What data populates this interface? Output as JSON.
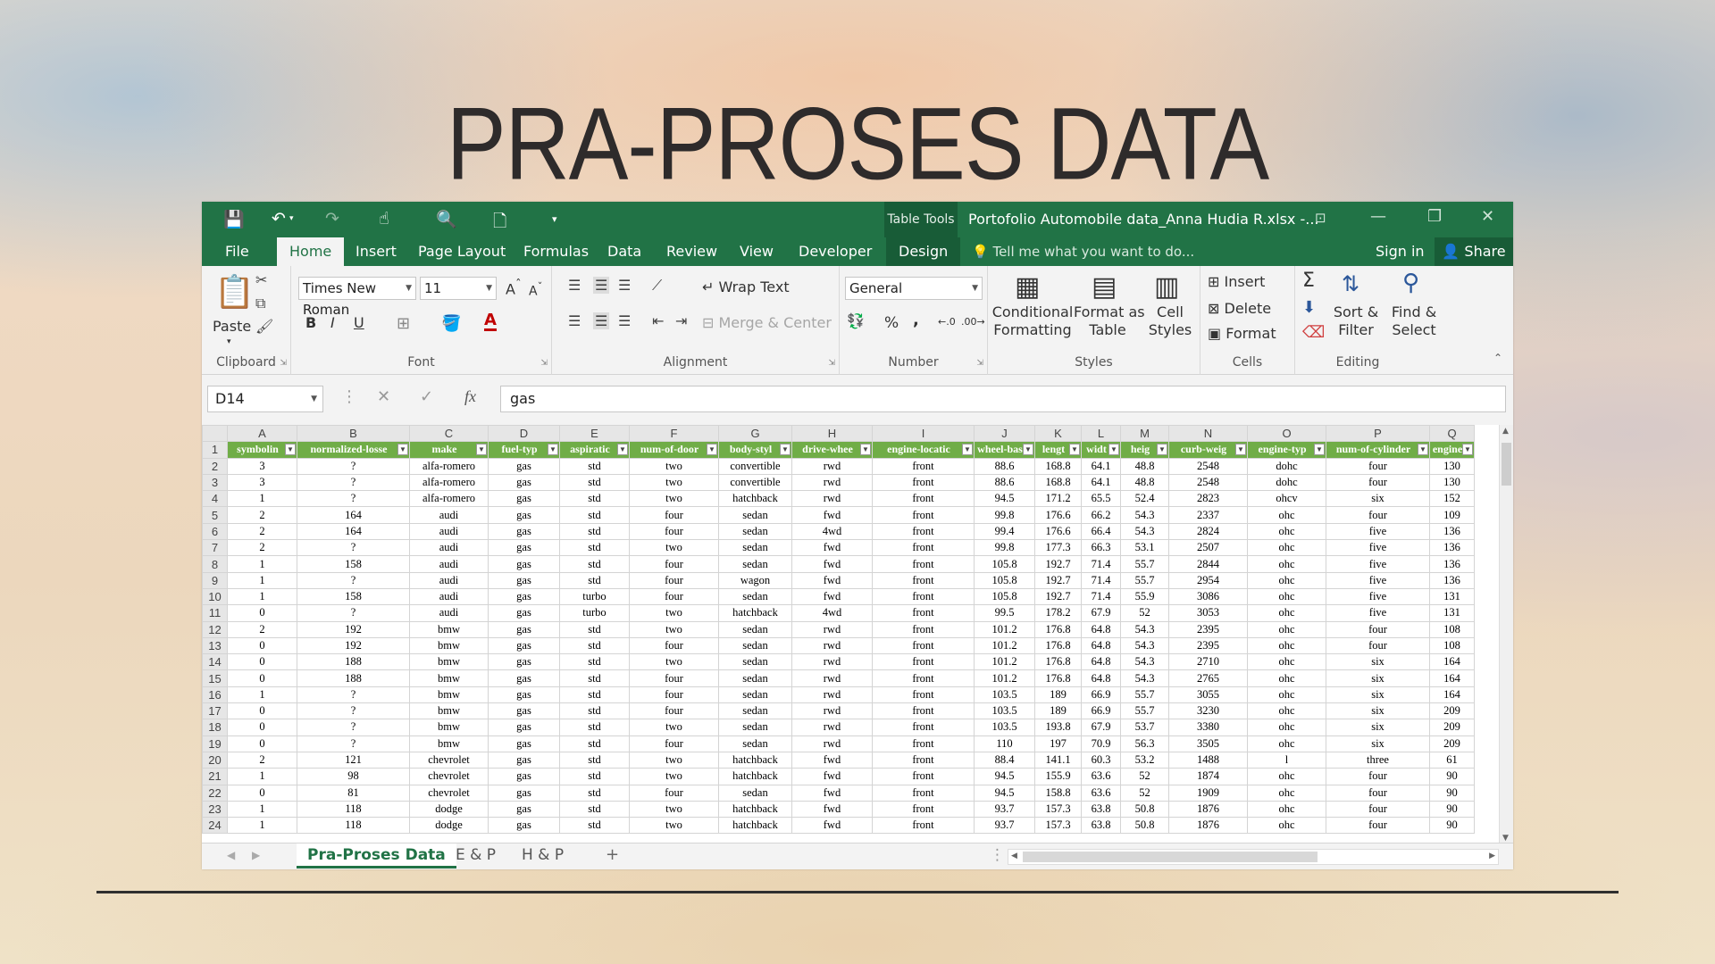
{
  "slide": {
    "title": "PRA-PROSES DATA"
  },
  "titlebar": {
    "table_tools": "Table Tools",
    "doc_title": "Portofolio Automobile data_Anna Hudia R.xlsx -..."
  },
  "tabs": {
    "file": "File",
    "home": "Home",
    "insert": "Insert",
    "page_layout": "Page Layout",
    "formulas": "Formulas",
    "data": "Data",
    "review": "Review",
    "view": "View",
    "developer": "Developer",
    "design": "Design",
    "tell": "Tell me what you want to do...",
    "signin": "Sign in",
    "share": "Share"
  },
  "ribbon": {
    "clipboard": {
      "label": "Clipboard",
      "paste": "Paste"
    },
    "font": {
      "label": "Font",
      "name": "Times New Roman",
      "size": "11",
      "bold": "B",
      "italic": "I",
      "underline": "U"
    },
    "alignment": {
      "label": "Alignment",
      "wrap": "Wrap Text",
      "merge": "Merge & Center"
    },
    "number": {
      "label": "Number",
      "format": "General",
      "percent": "%",
      "comma": ","
    },
    "styles": {
      "label": "Styles",
      "cond1": "Conditional",
      "cond2": "Formatting",
      "fmt1": "Format as",
      "fmt2": "Table",
      "cell1": "Cell",
      "cell2": "Styles"
    },
    "cells": {
      "label": "Cells",
      "insert": "Insert",
      "delete": "Delete",
      "format": "Format"
    },
    "editing": {
      "label": "Editing",
      "sort1": "Sort &",
      "sort2": "Filter",
      "find1": "Find &",
      "find2": "Select"
    }
  },
  "formula_bar": {
    "name_box": "D14",
    "fx": "fx",
    "value": "gas"
  },
  "grid": {
    "columns": [
      "A",
      "B",
      "C",
      "D",
      "E",
      "F",
      "G",
      "H",
      "I",
      "J",
      "K",
      "L",
      "M",
      "N",
      "O",
      "P",
      "Q"
    ],
    "headers": [
      "symbolin",
      "normalized-losse",
      "make",
      "fuel-typ",
      "aspiratic",
      "num-of-door",
      "body-styl",
      "drive-whee",
      "engine-locatic",
      "wheel-bas",
      "lengt",
      "widt",
      "heig",
      "curb-weig",
      "engine-typ",
      "num-of-cylinder",
      "engine"
    ],
    "rows": [
      [
        "3",
        "?",
        "alfa-romero",
        "gas",
        "std",
        "two",
        "convertible",
        "rwd",
        "front",
        "88.6",
        "168.8",
        "64.1",
        "48.8",
        "2548",
        "dohc",
        "four",
        "130"
      ],
      [
        "3",
        "?",
        "alfa-romero",
        "gas",
        "std",
        "two",
        "convertible",
        "rwd",
        "front",
        "88.6",
        "168.8",
        "64.1",
        "48.8",
        "2548",
        "dohc",
        "four",
        "130"
      ],
      [
        "1",
        "?",
        "alfa-romero",
        "gas",
        "std",
        "two",
        "hatchback",
        "rwd",
        "front",
        "94.5",
        "171.2",
        "65.5",
        "52.4",
        "2823",
        "ohcv",
        "six",
        "152"
      ],
      [
        "2",
        "164",
        "audi",
        "gas",
        "std",
        "four",
        "sedan",
        "fwd",
        "front",
        "99.8",
        "176.6",
        "66.2",
        "54.3",
        "2337",
        "ohc",
        "four",
        "109"
      ],
      [
        "2",
        "164",
        "audi",
        "gas",
        "std",
        "four",
        "sedan",
        "4wd",
        "front",
        "99.4",
        "176.6",
        "66.4",
        "54.3",
        "2824",
        "ohc",
        "five",
        "136"
      ],
      [
        "2",
        "?",
        "audi",
        "gas",
        "std",
        "two",
        "sedan",
        "fwd",
        "front",
        "99.8",
        "177.3",
        "66.3",
        "53.1",
        "2507",
        "ohc",
        "five",
        "136"
      ],
      [
        "1",
        "158",
        "audi",
        "gas",
        "std",
        "four",
        "sedan",
        "fwd",
        "front",
        "105.8",
        "192.7",
        "71.4",
        "55.7",
        "2844",
        "ohc",
        "five",
        "136"
      ],
      [
        "1",
        "?",
        "audi",
        "gas",
        "std",
        "four",
        "wagon",
        "fwd",
        "front",
        "105.8",
        "192.7",
        "71.4",
        "55.7",
        "2954",
        "ohc",
        "five",
        "136"
      ],
      [
        "1",
        "158",
        "audi",
        "gas",
        "turbo",
        "four",
        "sedan",
        "fwd",
        "front",
        "105.8",
        "192.7",
        "71.4",
        "55.9",
        "3086",
        "ohc",
        "five",
        "131"
      ],
      [
        "0",
        "?",
        "audi",
        "gas",
        "turbo",
        "two",
        "hatchback",
        "4wd",
        "front",
        "99.5",
        "178.2",
        "67.9",
        "52",
        "3053",
        "ohc",
        "five",
        "131"
      ],
      [
        "2",
        "192",
        "bmw",
        "gas",
        "std",
        "two",
        "sedan",
        "rwd",
        "front",
        "101.2",
        "176.8",
        "64.8",
        "54.3",
        "2395",
        "ohc",
        "four",
        "108"
      ],
      [
        "0",
        "192",
        "bmw",
        "gas",
        "std",
        "four",
        "sedan",
        "rwd",
        "front",
        "101.2",
        "176.8",
        "64.8",
        "54.3",
        "2395",
        "ohc",
        "four",
        "108"
      ],
      [
        "0",
        "188",
        "bmw",
        "gas",
        "std",
        "two",
        "sedan",
        "rwd",
        "front",
        "101.2",
        "176.8",
        "64.8",
        "54.3",
        "2710",
        "ohc",
        "six",
        "164"
      ],
      [
        "0",
        "188",
        "bmw",
        "gas",
        "std",
        "four",
        "sedan",
        "rwd",
        "front",
        "101.2",
        "176.8",
        "64.8",
        "54.3",
        "2765",
        "ohc",
        "six",
        "164"
      ],
      [
        "1",
        "?",
        "bmw",
        "gas",
        "std",
        "four",
        "sedan",
        "rwd",
        "front",
        "103.5",
        "189",
        "66.9",
        "55.7",
        "3055",
        "ohc",
        "six",
        "164"
      ],
      [
        "0",
        "?",
        "bmw",
        "gas",
        "std",
        "four",
        "sedan",
        "rwd",
        "front",
        "103.5",
        "189",
        "66.9",
        "55.7",
        "3230",
        "ohc",
        "six",
        "209"
      ],
      [
        "0",
        "?",
        "bmw",
        "gas",
        "std",
        "two",
        "sedan",
        "rwd",
        "front",
        "103.5",
        "193.8",
        "67.9",
        "53.7",
        "3380",
        "ohc",
        "six",
        "209"
      ],
      [
        "0",
        "?",
        "bmw",
        "gas",
        "std",
        "four",
        "sedan",
        "rwd",
        "front",
        "110",
        "197",
        "70.9",
        "56.3",
        "3505",
        "ohc",
        "six",
        "209"
      ],
      [
        "2",
        "121",
        "chevrolet",
        "gas",
        "std",
        "two",
        "hatchback",
        "fwd",
        "front",
        "88.4",
        "141.1",
        "60.3",
        "53.2",
        "1488",
        "l",
        "three",
        "61"
      ],
      [
        "1",
        "98",
        "chevrolet",
        "gas",
        "std",
        "two",
        "hatchback",
        "fwd",
        "front",
        "94.5",
        "155.9",
        "63.6",
        "52",
        "1874",
        "ohc",
        "four",
        "90"
      ],
      [
        "0",
        "81",
        "chevrolet",
        "gas",
        "std",
        "four",
        "sedan",
        "fwd",
        "front",
        "94.5",
        "158.8",
        "63.6",
        "52",
        "1909",
        "ohc",
        "four",
        "90"
      ],
      [
        "1",
        "118",
        "dodge",
        "gas",
        "std",
        "two",
        "hatchback",
        "fwd",
        "front",
        "93.7",
        "157.3",
        "63.8",
        "50.8",
        "1876",
        "ohc",
        "four",
        "90"
      ],
      [
        "1",
        "118",
        "dodge",
        "gas",
        "std",
        "two",
        "hatchback",
        "fwd",
        "front",
        "93.7",
        "157.3",
        "63.8",
        "50.8",
        "1876",
        "ohc",
        "four",
        "90"
      ]
    ]
  },
  "sheets": {
    "tab1": "Pra-Proses Data",
    "tab2": "E & P",
    "tab3": "H & P",
    "add": "+"
  },
  "colors": {
    "excel_green": "#217346",
    "header_green": "#70ad47"
  }
}
